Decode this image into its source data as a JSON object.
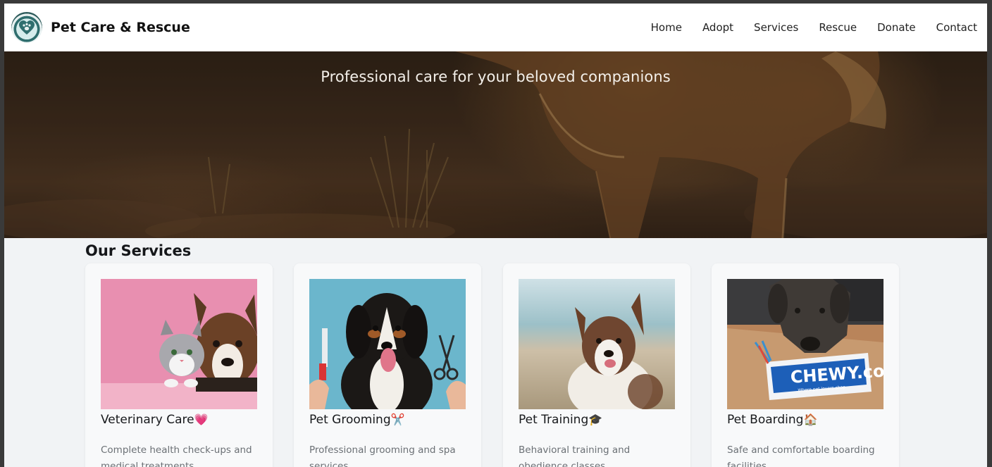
{
  "brand": {
    "name": "Pet Care & Rescue"
  },
  "nav": {
    "items": [
      "Home",
      "Adopt",
      "Services",
      "Rescue",
      "Donate",
      "Contact"
    ]
  },
  "hero": {
    "tagline": "Professional care for your beloved companions"
  },
  "services": {
    "title": "Our Services",
    "cards": [
      {
        "title": "Veterinary Care",
        "emoji": "💗",
        "description": "Complete health check-ups and medical treatments"
      },
      {
        "title": "Pet Grooming",
        "emoji": "✂️",
        "description": "Professional grooming and spa services"
      },
      {
        "title": "Pet Training",
        "emoji": "🎓",
        "description": "Behavioral training and obedience classes"
      },
      {
        "title": "Pet Boarding",
        "emoji": "🏠",
        "description": "Safe and comfortable boarding facilities"
      }
    ],
    "boarding_toy_text": "CHEWY.com",
    "boarding_toy_subtext": "Where pet lovers shop"
  },
  "colors": {
    "accent_heart": "#e8385b",
    "card_background": "#f8f9fa",
    "section_background": "#f1f3f5"
  }
}
